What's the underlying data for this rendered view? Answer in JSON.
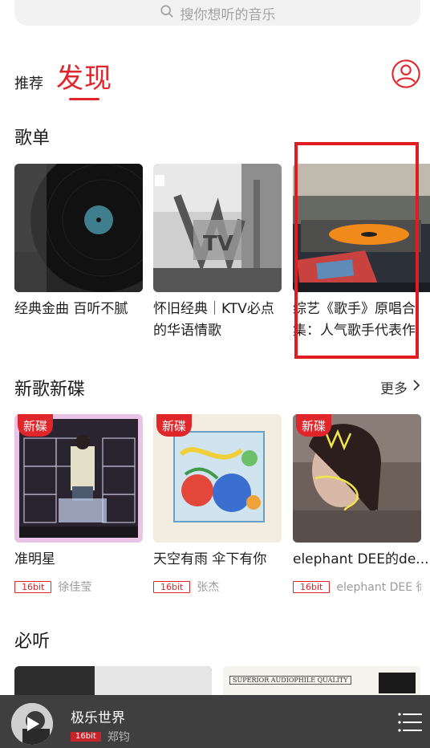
{
  "search": {
    "placeholder": "搜你想听的音乐"
  },
  "tabs": {
    "recommend": "推荐",
    "discover": "发现"
  },
  "playlists": {
    "title": "歌单",
    "items": [
      {
        "title": "经典金曲 百听不腻"
      },
      {
        "title": "怀旧经典｜KTV必点的华语情歌"
      },
      {
        "title": "综艺《歌手》原唱合集：人气歌手代表作"
      }
    ]
  },
  "new_albums": {
    "title": "新歌新碟",
    "more": "更多",
    "tag": "新碟",
    "quality": "16bit",
    "items": [
      {
        "title": "准明星",
        "artist": "徐佳莹"
      },
      {
        "title": "天空有雨 伞下有你",
        "artist": "张杰"
      },
      {
        "title": "elephant DEE的de...",
        "artist": "elephant DEE 徐..."
      }
    ]
  },
  "must_listen": {
    "title": "必听",
    "banner_text": "SUPERIOR AUDIOPHILE QUALITY"
  },
  "player": {
    "title": "极乐世界",
    "quality": "16bit",
    "artist": "郑钧"
  },
  "icons": {
    "search": "search-icon",
    "profile": "user-profile-icon",
    "more": "chevron-right-icon",
    "playlist": "list-icon",
    "play": "play-icon"
  },
  "colors": {
    "accent": "#e0262b",
    "player_bg": "#3f3f3f"
  }
}
